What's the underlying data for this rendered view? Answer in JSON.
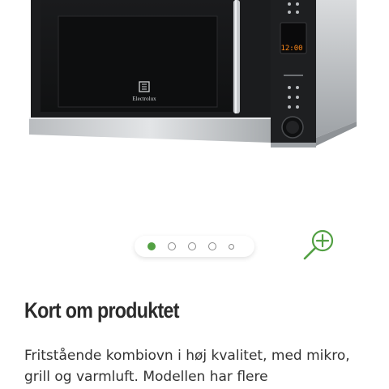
{
  "product_image": {
    "brand_logo_text": "Electrolux",
    "display_time": "12:00"
  },
  "carousel": {
    "slides": 5,
    "active_index": 0
  },
  "zoom": {
    "icon": "zoom-in-icon"
  },
  "section": {
    "title": "Kort om produktet",
    "description": "Fritstående kombiovn i høj kvalitet, med mikro, grill og varmluft. Modellen har flere"
  },
  "colors": {
    "accent": "#52a043",
    "text": "#2b2b2b"
  }
}
